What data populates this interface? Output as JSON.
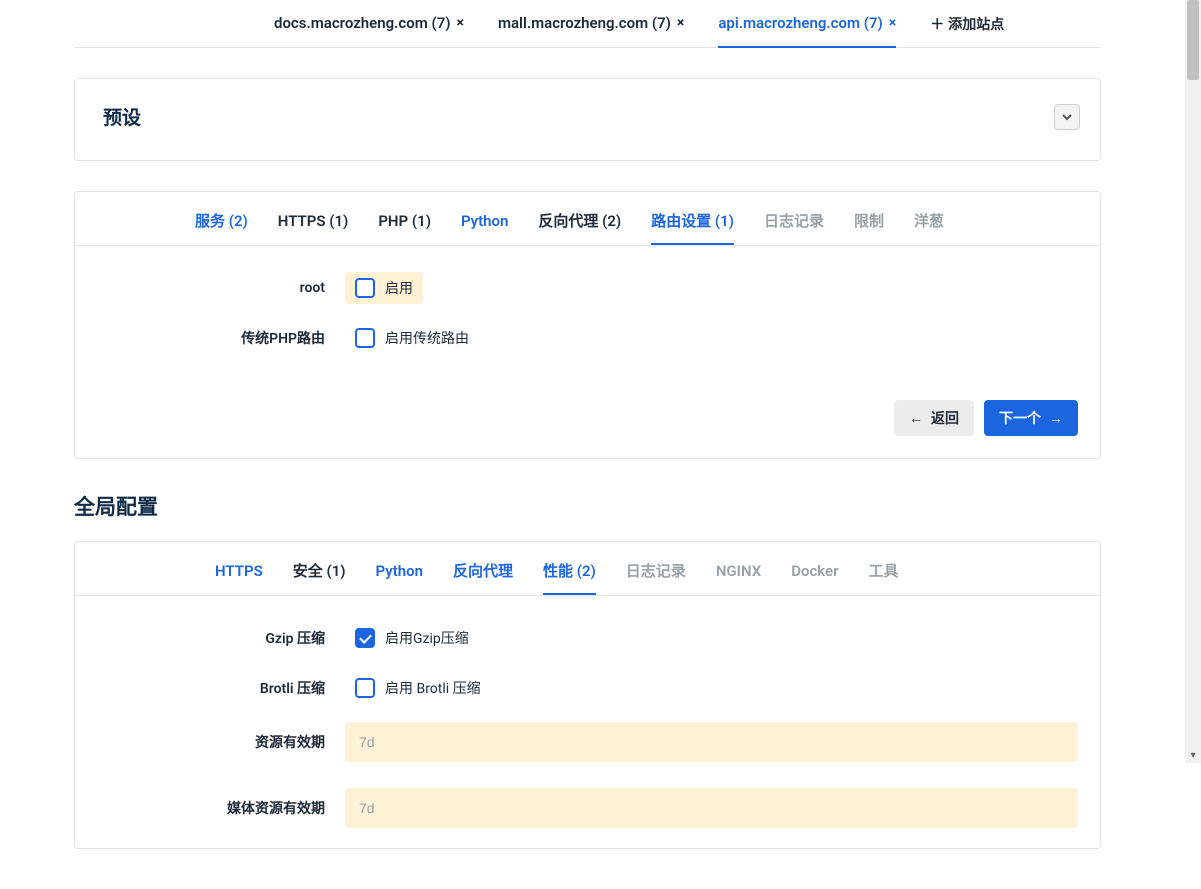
{
  "site_tabs": {
    "items": [
      {
        "label": "docs.macrozheng.com (7)",
        "active": false
      },
      {
        "label": "mall.macrozheng.com (7)",
        "active": false
      },
      {
        "label": "api.macrozheng.com (7)",
        "active": true
      }
    ],
    "add_label": "添加站点"
  },
  "preset": {
    "title": "预设"
  },
  "site_config_tabs": [
    {
      "label": "服务 (2)",
      "state": "done"
    },
    {
      "label": "HTTPS (1)",
      "state": "normal"
    },
    {
      "label": "PHP (1)",
      "state": "normal"
    },
    {
      "label": "Python",
      "state": "done"
    },
    {
      "label": "反向代理 (2)",
      "state": "normal"
    },
    {
      "label": "路由设置 (1)",
      "state": "active"
    },
    {
      "label": "日志记录",
      "state": "disabled"
    },
    {
      "label": "限制",
      "state": "disabled"
    },
    {
      "label": "洋葱",
      "state": "disabled"
    }
  ],
  "route_form": {
    "root_label": "root",
    "root_check_label": "启用",
    "php_route_label": "传统PHP路由",
    "php_route_check_label": "启用传统路由"
  },
  "buttons": {
    "back": "返回",
    "next": "下一个"
  },
  "global_heading": "全局配置",
  "global_tabs": [
    {
      "label": "HTTPS",
      "state": "done"
    },
    {
      "label": "安全 (1)",
      "state": "normal"
    },
    {
      "label": "Python",
      "state": "done"
    },
    {
      "label": "反向代理",
      "state": "done"
    },
    {
      "label": "性能 (2)",
      "state": "active"
    },
    {
      "label": "日志记录",
      "state": "disabled"
    },
    {
      "label": "NGINX",
      "state": "disabled"
    },
    {
      "label": "Docker",
      "state": "disabled"
    },
    {
      "label": "工具",
      "state": "disabled"
    }
  ],
  "perf_form": {
    "gzip_label": "Gzip 压缩",
    "gzip_check_label": "启用Gzip压缩",
    "brotli_label": "Brotli 压缩",
    "brotli_check_label": "启用 Brotli 压缩",
    "asset_expire_label": "资源有效期",
    "asset_expire_value": "7d",
    "media_expire_label": "媒体资源有效期",
    "media_expire_value": "7d"
  }
}
